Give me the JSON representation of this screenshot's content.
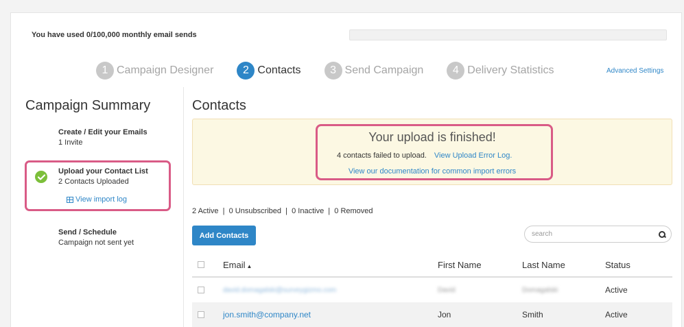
{
  "usage": {
    "text": "You have used 0/100,000 monthly email sends"
  },
  "steps": [
    {
      "num": "1",
      "label": "Campaign Designer"
    },
    {
      "num": "2",
      "label": "Contacts"
    },
    {
      "num": "3",
      "label": "Send Campaign"
    },
    {
      "num": "4",
      "label": "Delivery Statistics"
    }
  ],
  "advanced_settings": "Advanced Settings",
  "sidebar": {
    "title": "Campaign Summary",
    "items": [
      {
        "title": "Create / Edit your Emails",
        "sub": "1 Invite"
      },
      {
        "title": "Upload your Contact List",
        "sub": "2 Contacts Uploaded",
        "link": "View import log"
      },
      {
        "title": "Send / Schedule",
        "sub": "Campaign not sent yet"
      }
    ]
  },
  "main": {
    "title": "Contacts",
    "alert": {
      "heading": "Your upload is finished!",
      "failed_text": "4 contacts failed to upload.",
      "error_log_link": "View Upload Error Log.",
      "docs_link": "View our documentation for common import errors"
    },
    "counts": "2 Active  |  0 Unsubscribed  |  0 Inactive  |  0 Removed",
    "add_button": "Add Contacts",
    "search": {
      "placeholder": "search",
      "value": ""
    },
    "table": {
      "headers": {
        "email": "Email",
        "first": "First Name",
        "last": "Last Name",
        "status": "Status"
      },
      "rows": [
        {
          "email": "david.domagalski@surveygizmo.com",
          "first": "David",
          "last": "Domagalski",
          "status": "Active"
        },
        {
          "email": "jon.smith@company.net",
          "first": "Jon",
          "last": "Smith",
          "status": "Active"
        }
      ]
    }
  },
  "colors": {
    "accent": "#2e86c7",
    "highlight": "#d95b86",
    "success": "#7cbf3a",
    "alert_bg": "#fcf8e3"
  }
}
